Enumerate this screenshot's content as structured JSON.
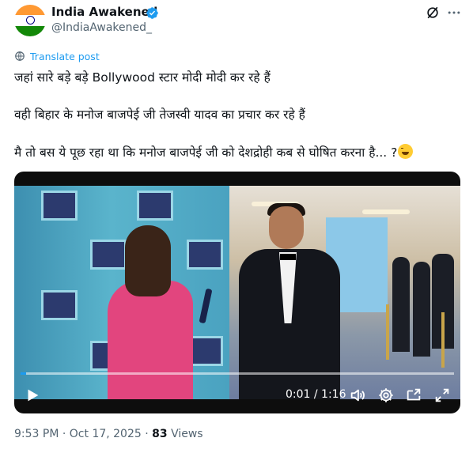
{
  "author": {
    "display_name": "India Awakened",
    "handle": "@IndiaAwakened_",
    "verified": true,
    "avatar": "indian-flag"
  },
  "header_actions": {
    "grok_icon": "grok-icon",
    "more_icon": "more-icon"
  },
  "translate": {
    "label": "Translate post",
    "icon": "translate-icon"
  },
  "tweet": {
    "lines": [
      "जहां सारे बड़े बड़े Bollywood स्टार मोदी मोदी कर रहे हैं",
      "वही बिहार के मनोज बाजपेई जी तेजस्वी यादव का प्रचार कर रहे हैं",
      "मै तो बस ये पूछ रहा था कि मनोज बाजपेई जी को देशद्रोही कब से घोषित करना है... ?"
    ],
    "emoji": "rolling-on-floor-laughing-emoji"
  },
  "video": {
    "current_time": "0:01",
    "duration": "1:16",
    "time_display": "0:01 / 1:16",
    "progress_fraction": 0.013,
    "controls": [
      "play-icon",
      "volume-icon",
      "settings-icon",
      "picture-in-picture-icon",
      "fullscreen-icon"
    ]
  },
  "meta": {
    "time": "9:53 PM",
    "date": "Oct 17, 2025",
    "separator": "·",
    "views_count": "83",
    "views_label": "Views"
  },
  "colors": {
    "accent": "#1d9bf0",
    "text_primary": "#0f1419",
    "text_secondary": "#536471"
  }
}
